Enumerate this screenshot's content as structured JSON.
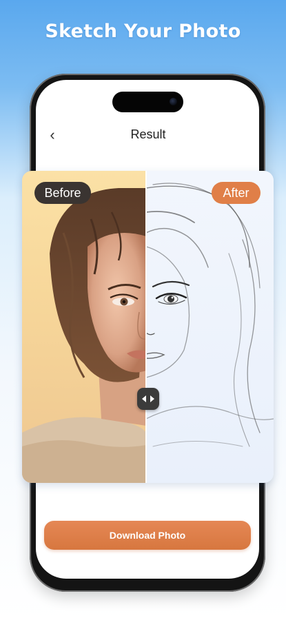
{
  "headline": "Sketch Your Photo",
  "header": {
    "back_icon": "chevron-left-icon",
    "title": "Result"
  },
  "comparison": {
    "before_label": "Before",
    "after_label": "After",
    "handle_icon": "left-right-arrows-icon"
  },
  "actions": {
    "download_label": "Download Photo"
  },
  "colors": {
    "accent": "#e07f48",
    "before_bg": "#f7d79a",
    "after_bg": "#eef3fc",
    "headline": "#ffffff",
    "background_top": "#5aa8ee"
  }
}
